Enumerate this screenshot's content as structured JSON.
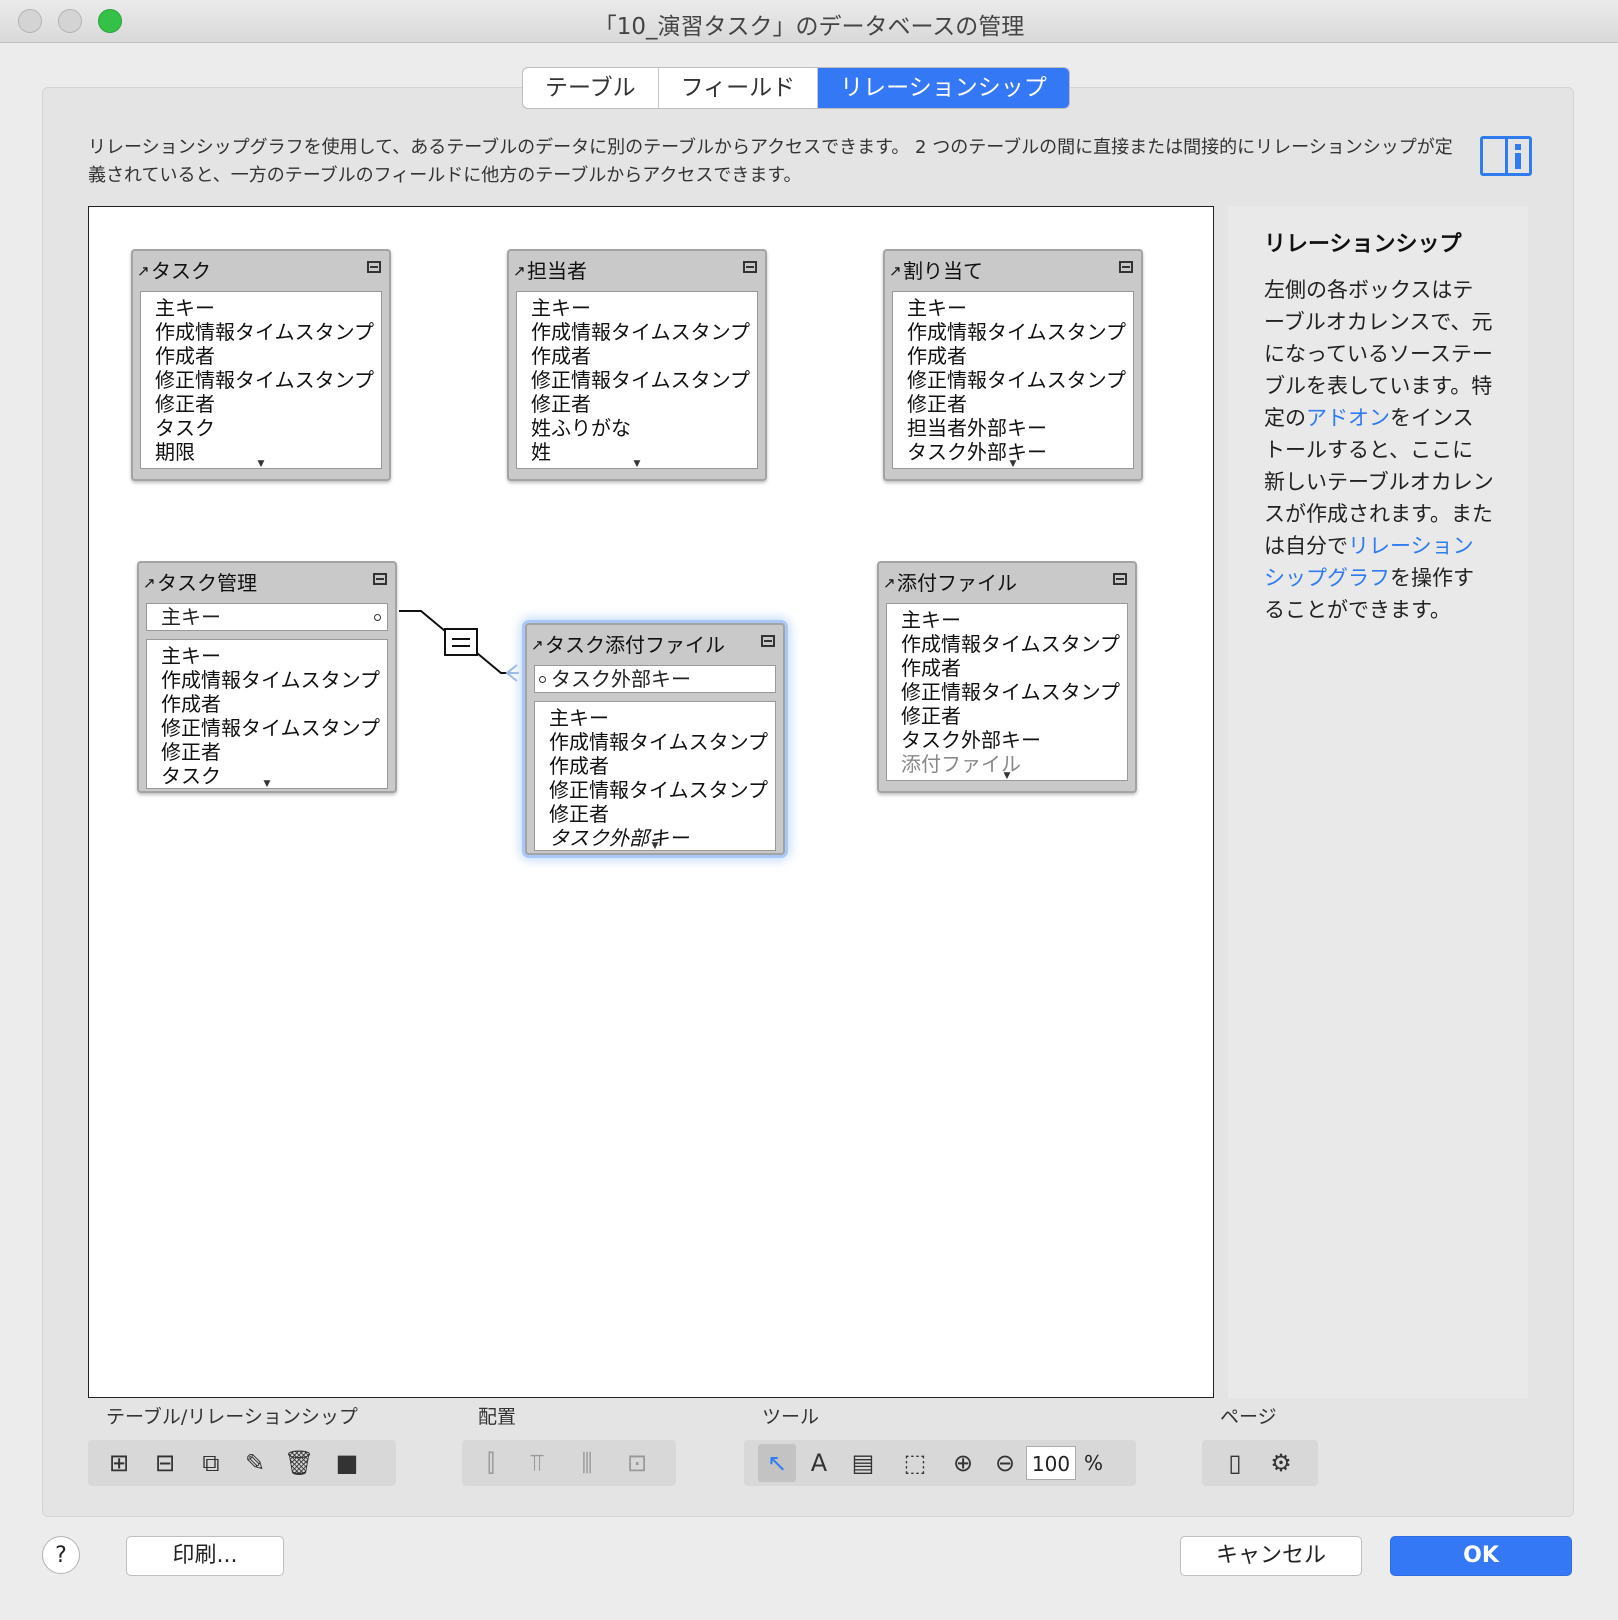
{
  "window": {
    "title": "「10_演習タスク」のデータベースの管理",
    "colors": {
      "close": "#d4d4d4",
      "minimize": "#d4d4d4",
      "zoom": "#35c148",
      "accent": "#3478f6"
    }
  },
  "tabs": [
    {
      "label": "テーブル"
    },
    {
      "label": "フィールド"
    },
    {
      "label": "リレーションシップ",
      "active": true
    }
  ],
  "description": "リレーションシップグラフを使用して、あるテーブルのデータに別のテーブルからアクセスできます。 2 つのテーブルの間に直接または間接的にリレーションシップが定義されていると、一方のテーブルのフィールドに他方のテーブルからアクセスできます。",
  "tables": {
    "task": {
      "name": "タスク",
      "fields": [
        "主キー",
        "作成情報タイムスタンプ",
        "作成者",
        "修正情報タイムスタンプ",
        "修正者",
        "タスク",
        "期限"
      ]
    },
    "assignee": {
      "name": "担当者",
      "fields": [
        "主キー",
        "作成情報タイムスタンプ",
        "作成者",
        "修正情報タイムスタンプ",
        "修正者",
        "姓ふりがな",
        "姓"
      ]
    },
    "assignment": {
      "name": "割り当て",
      "fields": [
        "主キー",
        "作成情報タイムスタンプ",
        "作成者",
        "修正情報タイムスタンプ",
        "修正者",
        "担当者外部キー",
        "タスク外部キー"
      ]
    },
    "task_manage": {
      "name": "タスク管理",
      "key": "主キー",
      "fields": [
        "主キー",
        "作成情報タイムスタンプ",
        "作成者",
        "修正情報タイムスタンプ",
        "修正者",
        "タスク"
      ]
    },
    "task_attach": {
      "name": "タスク添付ファイル",
      "key": "タスク外部キー",
      "fields": [
        "主キー",
        "作成情報タイムスタンプ",
        "作成者",
        "修正情報タイムスタンプ",
        "修正者",
        "タスク外部キー"
      ]
    },
    "attachment": {
      "name": "添付ファイル",
      "fields": [
        "主キー",
        "作成情報タイムスタンプ",
        "作成者",
        "修正情報タイムスタンプ",
        "修正者",
        "タスク外部キー",
        "添付ファイル"
      ]
    }
  },
  "sidebar": {
    "title": "リレーションシップ",
    "text1": "左側の各ボックスはテーブルオカレンスで、元になっているソーステーブルを表しています。特定の",
    "link1": "アドオン",
    "text2": "をインストールすると、ここに新しいテーブルオカレンスが作成されます。または自分で",
    "link2": "リレーションシップグラフ",
    "text3": "を操作することができます。"
  },
  "toolbar": {
    "group1_label": "テーブル/リレーションシップ",
    "group2_label": "配置",
    "group3_label": "ツール",
    "group4_label": "ページ",
    "zoom_value": "100",
    "zoom_unit": "%"
  },
  "footer": {
    "help": "?",
    "print": "印刷...",
    "cancel": "キャンセル",
    "ok": "OK"
  }
}
